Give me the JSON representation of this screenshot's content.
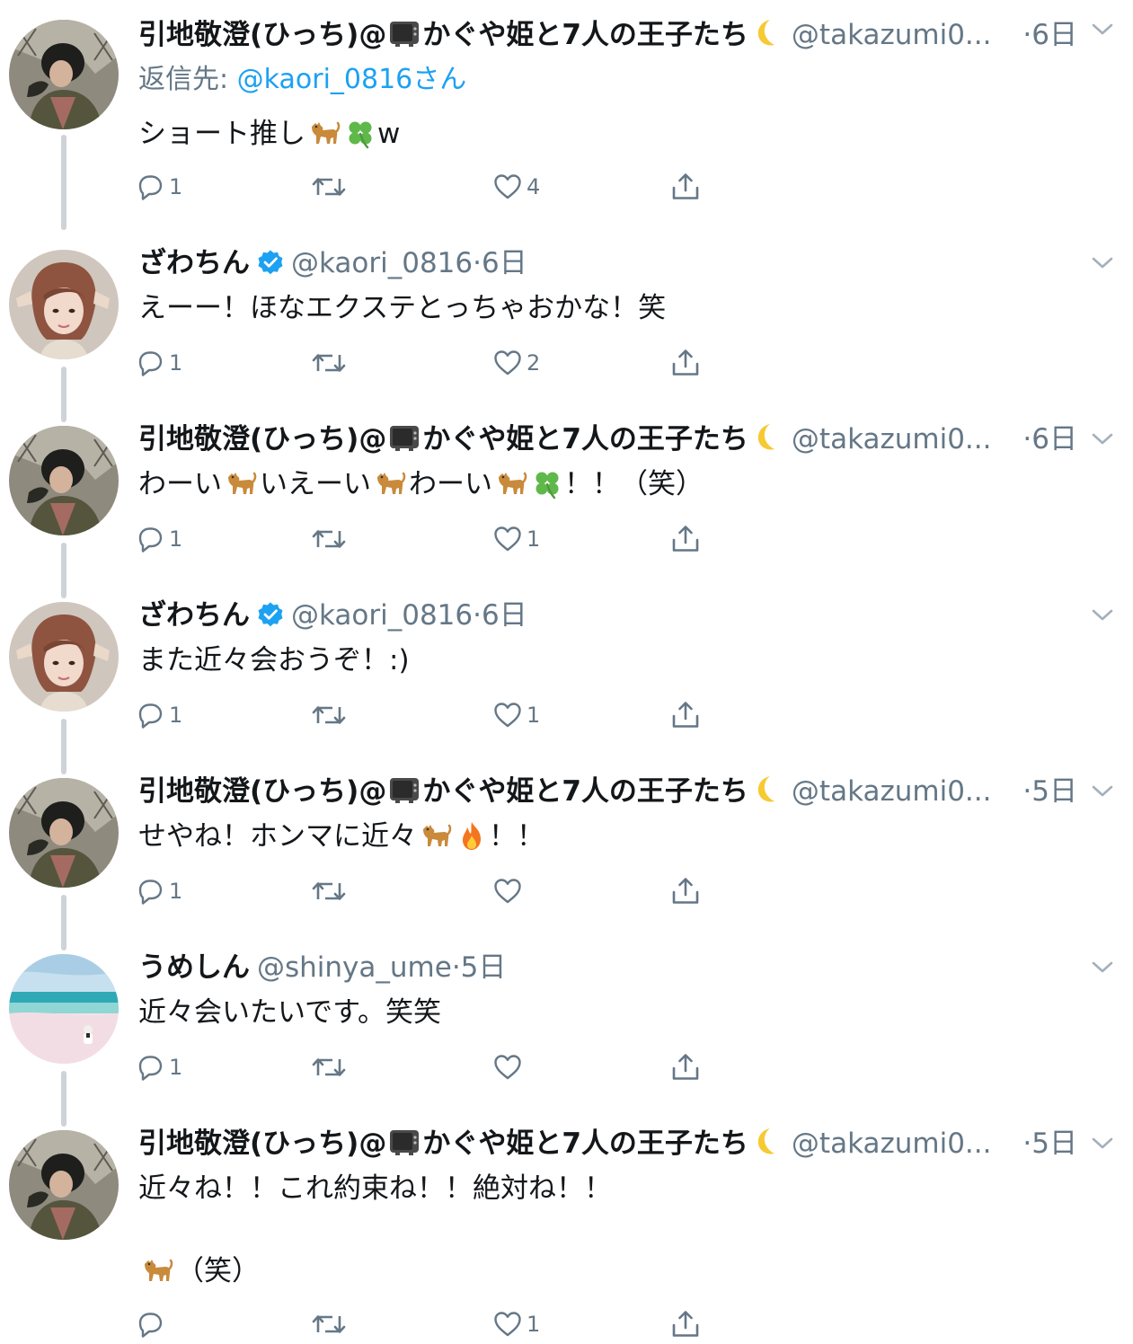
{
  "colors": {
    "name": "#14171a",
    "meta": "#657786",
    "link": "#1da1f2",
    "verified": "#1da1f2",
    "thread_line": "#cdd3d8"
  },
  "icons": {
    "reply": "speech-bubble-icon",
    "retweet": "retweet-arrows-icon",
    "like": "heart-icon",
    "share": "share-upload-icon",
    "more": "chevron-down-icon",
    "verified": "verified-badge-icon"
  },
  "tweets": [
    {
      "name": "引地敬澄(ひっち)@",
      "name_suffix": "かぐや姫と7人の王子たち",
      "handle": "@takazumi0...",
      "time": "·6日",
      "replying_label": "返信先: ",
      "replying_to": "@kaori_0816さん",
      "text_a": "ショート推し",
      "text_b": "w",
      "reply_count": "1",
      "retweet_count": "",
      "like_count": "4"
    },
    {
      "name": "ざわちん",
      "handle": "@kaori_0816",
      "time": "·6日",
      "text_a": "えーー！ほなエクステとっちゃおかな！笑",
      "reply_count": "1",
      "retweet_count": "",
      "like_count": "2"
    },
    {
      "name": "引地敬澄(ひっち)@",
      "name_suffix": "かぐや姫と7人の王子たち",
      "handle": "@takazumi0...",
      "time": "·6日",
      "text_a": "わーい",
      "text_b": "いえーい",
      "text_c": "わーい",
      "text_d": "！！（笑）",
      "reply_count": "1",
      "retweet_count": "",
      "like_count": "1"
    },
    {
      "name": "ざわちん",
      "handle": "@kaori_0816",
      "time": "·6日",
      "text_a": "また近々会おうぞ！:)",
      "reply_count": "1",
      "retweet_count": "",
      "like_count": "1"
    },
    {
      "name": "引地敬澄(ひっち)@",
      "name_suffix": "かぐや姫と7人の王子たち",
      "handle": "@takazumi0...",
      "time": "·5日",
      "text_a": "せやね！ホンマに近々",
      "text_b": "！！",
      "reply_count": "1",
      "retweet_count": "",
      "like_count": ""
    },
    {
      "name": "うめしん",
      "handle": "@shinya_ume",
      "time": "·5日",
      "text_a": "近々会いたいです。笑笑",
      "reply_count": "1",
      "retweet_count": "",
      "like_count": ""
    },
    {
      "name": "引地敬澄(ひっち)@",
      "name_suffix": "かぐや姫と7人の王子たち",
      "handle": "@takazumi0...",
      "time": "·5日",
      "text_a": "近々ね！！これ約束ね！！絶対ね！！",
      "text_b": "（笑）",
      "reply_count": "",
      "retweet_count": "",
      "like_count": "1"
    }
  ]
}
